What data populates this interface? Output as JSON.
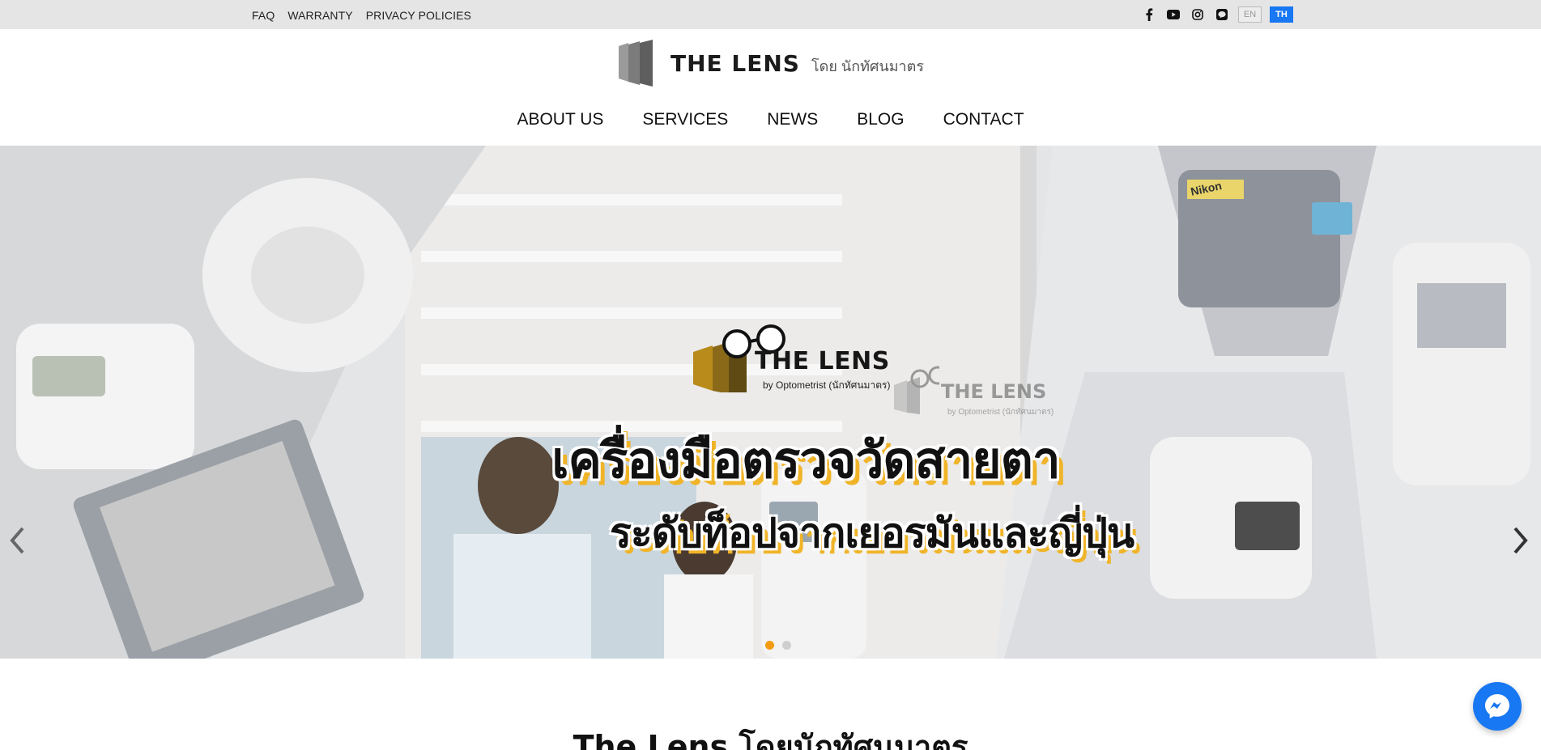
{
  "topbar": {
    "links": [
      "FAQ",
      "WARRANTY",
      "PRIVACY POLICIES"
    ],
    "social_icons": [
      "facebook-icon",
      "youtube-icon",
      "instagram-icon",
      "line-icon"
    ],
    "lang_en": "EN",
    "lang_th": "TH"
  },
  "header": {
    "logo_text": "THE LENS",
    "logo_subtitle": "โดย นักทัศนมาตร"
  },
  "nav": {
    "items": [
      "ABOUT US",
      "SERVICES",
      "NEWS",
      "BLOG",
      "CONTACT"
    ]
  },
  "hero": {
    "brand_title": "THE LENS",
    "brand_sub": "by Optometrist (นักทัศนมาตร)",
    "brand2_title": "THE LENS",
    "brand2_sub": "by Optometrist (นักทัศนมาตร)",
    "headline_line1": "เครื่องมือตรวจวัดสายตา",
    "headline_line2": "ระดับท็อปจากเยอรมันและญี่ปุ่น",
    "equipment_label": "Nikon",
    "prev_icon": "chevron-left-icon",
    "next_icon": "chevron-right-icon",
    "slides_total": 2,
    "active_slide": 1
  },
  "section": {
    "title": "The Lens โดยนักทัศนมาตร"
  },
  "messenger": {
    "icon": "messenger-icon"
  },
  "colors": {
    "topbar_bg": "#e5e5e5",
    "accent_blue": "#1877f2",
    "highlight_yellow": "#f0b429",
    "active_dot": "#f39c12"
  }
}
